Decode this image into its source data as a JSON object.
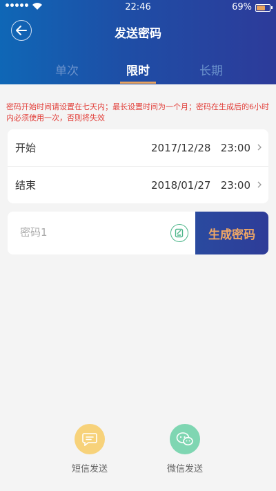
{
  "status_bar": {
    "time": "22:46",
    "battery": "69%",
    "battery_level": 0.69
  },
  "header": {
    "title": "发送密码"
  },
  "tabs": [
    {
      "label": "单次",
      "active": false
    },
    {
      "label": "限时",
      "active": true
    },
    {
      "label": "长期",
      "active": false
    }
  ],
  "notice": "密码开始时间请设置在七天内；最长设置时间为一个月；密码在生成后的6小时内必须使用一次，否则将失效",
  "time_rows": [
    {
      "label": "开始",
      "value": "2017/12/28   23:00"
    },
    {
      "label": "结束",
      "value": "2018/01/27   23:00"
    }
  ],
  "password": {
    "placeholder": "密码1",
    "value": "",
    "generate_label": "生成密码"
  },
  "share": [
    {
      "label": "短信发送",
      "icon": "sms-icon",
      "color": "#f7d27a"
    },
    {
      "label": "微信发送",
      "icon": "wechat-icon",
      "color": "#7fd6b2"
    }
  ],
  "colors": {
    "accent": "#e8a35f",
    "notice": "#e2403b",
    "header_start": "#0f67b6",
    "header_end": "#2d3b9a"
  }
}
